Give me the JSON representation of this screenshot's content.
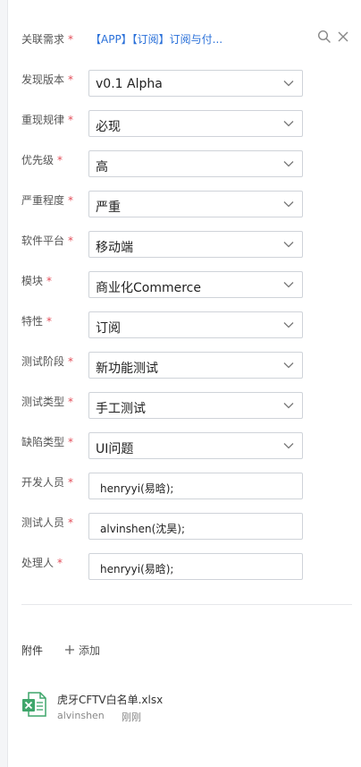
{
  "related": {
    "label": "关联需求",
    "value": "【APP】【订阅】订阅与付..."
  },
  "fields": {
    "version": {
      "label": "发现版本",
      "value": "v0.1 Alpha"
    },
    "repro": {
      "label": "重现规律",
      "value": "必现"
    },
    "priority": {
      "label": "优先级",
      "value": "高"
    },
    "severity": {
      "label": "严重程度",
      "value": "严重"
    },
    "platform": {
      "label": "软件平台",
      "value": "移动端"
    },
    "module": {
      "label": "模块",
      "value": "商业化Commerce"
    },
    "feature": {
      "label": "特性",
      "value": "订阅"
    },
    "test_stage": {
      "label": "测试阶段",
      "value": "新功能测试"
    },
    "test_type": {
      "label": "测试类型",
      "value": "手工测试"
    },
    "defect_type": {
      "label": "缺陷类型",
      "value": "UI问题"
    },
    "developer": {
      "label": "开发人员",
      "value": "henryyi(易晗);"
    },
    "tester": {
      "label": "测试人员",
      "value": "alvinshen(沈昊);"
    },
    "handler": {
      "label": "处理人",
      "value": "henryyi(易晗);"
    }
  },
  "required_mark": "*",
  "attachments": {
    "label": "附件",
    "add_label": "添加",
    "files": [
      {
        "name": "虎牙CFTV白名单.xlsx",
        "user": "alvinshen",
        "time": "刚刚",
        "icon": "excel-file-icon"
      }
    ]
  },
  "colors": {
    "link": "#2a70d9",
    "required": "#e34d59",
    "excel": "#3fa66b"
  }
}
